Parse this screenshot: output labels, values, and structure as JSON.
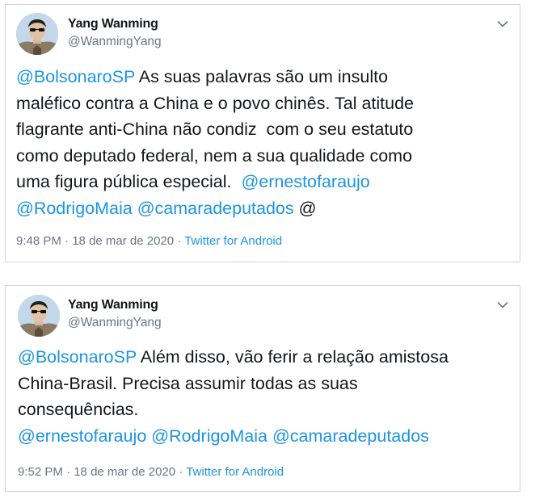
{
  "tweets": [
    {
      "author": {
        "name": "Yang Wanming",
        "handle": "@WanmingYang"
      },
      "lines": [
        [
          {
            "t": "@BolsonaroSP",
            "m": true
          },
          {
            "t": " As suas palavras são um insulto",
            "m": false
          }
        ],
        [
          {
            "t": "maléfico contra a China e o povo chinês. Tal atitude",
            "m": false
          }
        ],
        [
          {
            "t": "flagrante anti-China não condiz  com o seu estatuto",
            "m": false
          }
        ],
        [
          {
            "t": "como deputado federal, nem a sua qualidade como",
            "m": false
          }
        ],
        [
          {
            "t": "uma figura pública especial.  ",
            "m": false
          },
          {
            "t": "@ernestofaraujo",
            "m": true
          }
        ],
        [
          {
            "t": "@RodrigoMaia",
            "m": true
          },
          {
            "t": " ",
            "m": false
          },
          {
            "t": "@camaradeputados",
            "m": true
          },
          {
            "t": " @",
            "m": false
          }
        ]
      ],
      "time": "9:48 PM",
      "date": "18 de mar de 2020",
      "source": "Twitter for Android"
    },
    {
      "author": {
        "name": "Yang Wanming",
        "handle": "@WanmingYang"
      },
      "lines": [
        [
          {
            "t": "@BolsonaroSP",
            "m": true
          },
          {
            "t": " Além disso, vão ferir a relação amistosa",
            "m": false
          }
        ],
        [
          {
            "t": "China-Brasil. Precisa assumir todas as suas",
            "m": false
          }
        ],
        [
          {
            "t": "consequências.",
            "m": false
          }
        ],
        [
          {
            "t": "@ernestofaraujo",
            "m": true
          },
          {
            "t": " ",
            "m": false
          },
          {
            "t": "@RodrigoMaia",
            "m": true
          },
          {
            "t": " ",
            "m": false
          },
          {
            "t": "@camaradeputados",
            "m": true
          }
        ]
      ],
      "time": "9:52 PM",
      "date": "18 de mar de 2020",
      "source": "Twitter for Android"
    }
  ],
  "separators": {
    "meta_dot": " · "
  },
  "icons": {
    "avatar": "avatar-photo",
    "chevron": "chevron-down-icon"
  },
  "colors": {
    "link": "#1b95e0",
    "text": "#14171a",
    "muted": "#657786",
    "border": "#cfd3d6"
  }
}
